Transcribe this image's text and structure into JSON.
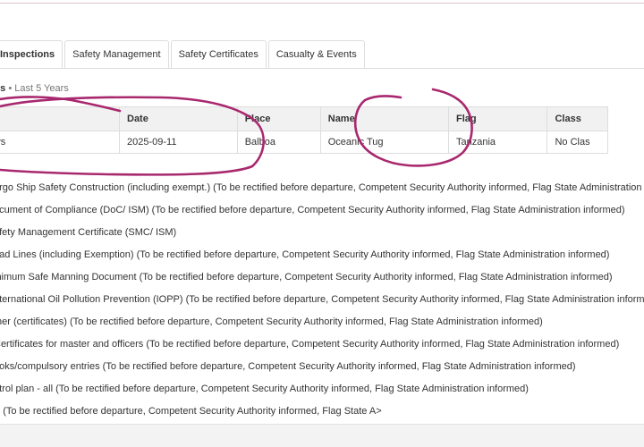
{
  "tabs": [
    {
      "label": "Inspections",
      "active": true
    },
    {
      "label": "Safety Management",
      "active": false
    },
    {
      "label": "Safety Certificates",
      "active": false
    },
    {
      "label": "Casualty & Events",
      "active": false
    }
  ],
  "section": {
    "title": "es",
    "separator": "•",
    "period": "Last 5 Years"
  },
  "table": {
    "headers": [
      "",
      "Date",
      "Place",
      "Name",
      "Flag",
      "Class"
    ],
    "rows": [
      [
        "of Days",
        "2025-09-11",
        "Balboa",
        "Oceanic Tug",
        "Tanzania",
        "No Clas"
      ]
    ]
  },
  "deficiencies": [
    "argo Ship Safety Construction (including exempt.) (To be rectified before departure, Competent Security Authority informed, Flag State Administration informed)",
    "ocument of Compliance (DoC/ ISM) (To be rectified before departure, Competent Security Authority informed, Flag State Administration informed)",
    "afety Management Certificate (SMC/ ISM)",
    "oad Lines (including Exemption) (To be rectified before departure, Competent Security Authority informed, Flag State Administration informed)",
    "inimum Safe Manning Document (To be rectified before departure, Competent Security Authority informed, Flag State Administration informed)",
    "nternational Oil Pollution Prevention (IOPP) (To be rectified before departure, Competent Security Authority informed, Flag State Administration informed)",
    "ther (certificates) (To be rectified before departure, Competent Security Authority informed, Flag State Administration informed)",
    "Certificates for master and officers (To be rectified before departure, Competent Security Authority informed, Flag State Administration informed)",
    "ooks/compulsory entries (To be rectified before departure, Competent Security Authority informed, Flag State Administration informed)",
    "ntrol plan - all (To be rectified before departure, Competent Security Authority informed, Flag State Administration informed)",
    "P (To be rectified before departure, Competent Security Authority informed, Flag State A>"
  ],
  "annotation_color": "#a8286e"
}
